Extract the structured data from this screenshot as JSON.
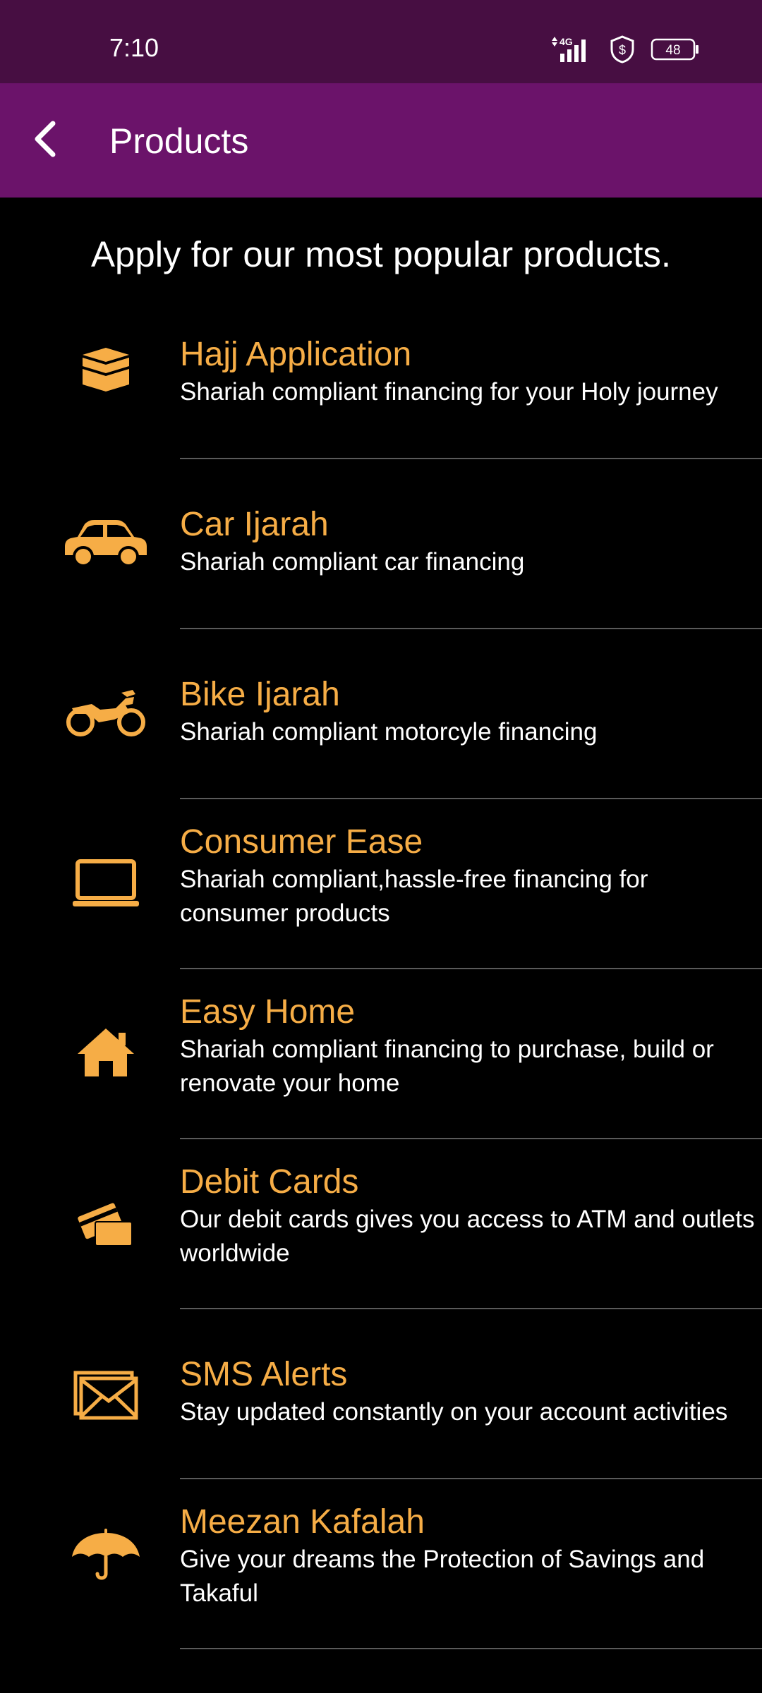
{
  "status_bar": {
    "time": "7:10",
    "network": "4G",
    "battery": "48"
  },
  "app_bar": {
    "title": "Products",
    "back_icon": "chevron-left-icon"
  },
  "intro": "Apply for our most popular products.",
  "colors": {
    "status_bar_bg": "#470e42",
    "app_bar_bg": "#6b136a",
    "accent": "#f6ad46",
    "background": "#000000",
    "text": "#ffffff"
  },
  "products": [
    {
      "icon": "kaaba-icon",
      "title": "Hajj Application",
      "description": "Shariah compliant financing for your Holy journey"
    },
    {
      "icon": "car-icon",
      "title": "Car Ijarah",
      "description": "Shariah compliant car financing"
    },
    {
      "icon": "motorcycle-icon",
      "title": "Bike Ijarah",
      "description": "Shariah compliant motorcyle financing"
    },
    {
      "icon": "laptop-icon",
      "title": "Consumer Ease",
      "description": "Shariah compliant,hassle-free financing for consumer products"
    },
    {
      "icon": "home-icon",
      "title": "Easy Home",
      "description": "Shariah compliant financing to purchase, build or renovate your home"
    },
    {
      "icon": "debit-card-icon",
      "title": "Debit Cards",
      "description": "Our debit cards gives you access to ATM and outlets worldwide"
    },
    {
      "icon": "envelope-icon",
      "title": "SMS Alerts",
      "description": "Stay updated constantly on your account activities"
    },
    {
      "icon": "umbrella-icon",
      "title": "Meezan Kafalah",
      "description": "Give your dreams the Protection of Savings and Takaful"
    }
  ]
}
